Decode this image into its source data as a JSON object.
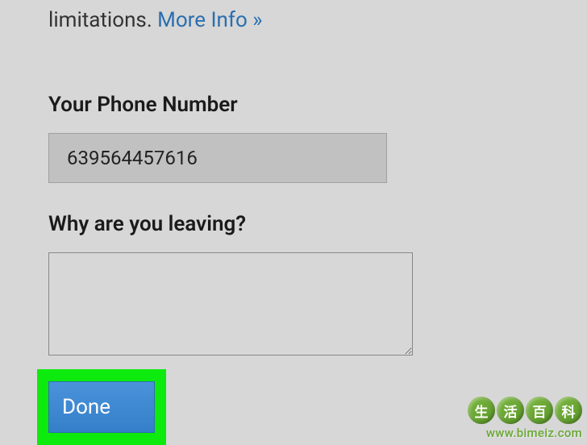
{
  "header": {
    "partial_text": "limitations. ",
    "more_info_label": "More Info »"
  },
  "form": {
    "phone": {
      "label": "Your Phone Number",
      "value": "639564457616"
    },
    "reason": {
      "label": "Why are you leaving?",
      "value": ""
    },
    "done_label": "Done"
  },
  "watermark": {
    "chars": [
      "生",
      "活",
      "百",
      "科"
    ],
    "url": "www.bimeiz.com"
  }
}
